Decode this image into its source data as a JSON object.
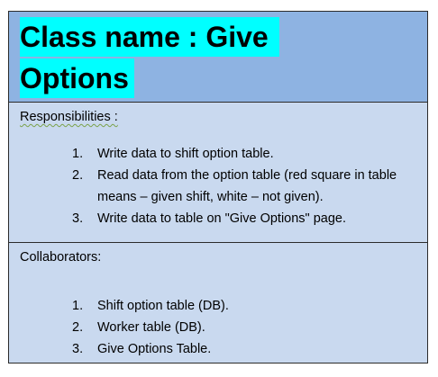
{
  "card": {
    "title_line1": "Class name : Give",
    "title_line2": "Options",
    "responsibilities": {
      "label": "Responsibilities :",
      "items": [
        {
          "num": "1.",
          "text": "Write data to shift option table."
        },
        {
          "num": "2.",
          "text": "Read data from the option table (red square in table means – given shift, white – not given)."
        },
        {
          "num": "3.",
          "text": "Write data to table on \"Give Options\" page."
        }
      ]
    },
    "collaborators": {
      "label": "Collaborators:",
      "items": [
        {
          "num": "1.",
          "text": "Shift option table (DB)."
        },
        {
          "num": "2.",
          "text": "Worker table (DB)."
        },
        {
          "num": "3.",
          "text": "Give Options Table."
        }
      ]
    }
  }
}
